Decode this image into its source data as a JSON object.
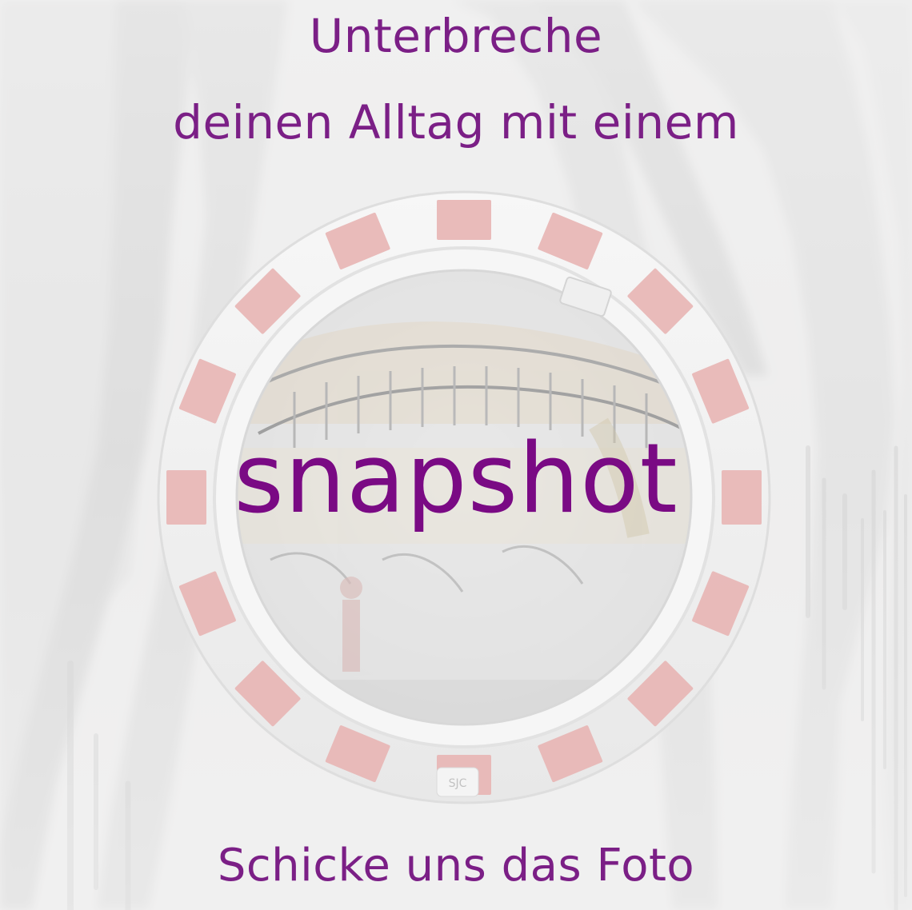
{
  "poster": {
    "line1": "Unterbreche",
    "line2": "deinen Alltag mit einem",
    "keyword": "snapshot",
    "bottom": "Schicke uns das Foto"
  },
  "mirror": {
    "mark": "SJC"
  },
  "colors": {
    "text_purple": "#7b1f86",
    "keyword_purple": "#7a0a84",
    "mirror_red": "#e7b9b8",
    "mirror_white": "#f4f4f4",
    "background": "#e7e6e6"
  }
}
